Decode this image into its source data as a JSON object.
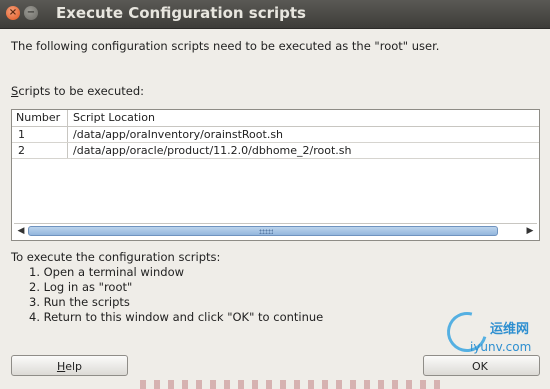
{
  "window": {
    "title": "Execute Configuration scripts"
  },
  "description": "The following configuration scripts need to be executed as the \"root\" user.",
  "scripts_label": {
    "first": "S",
    "rest": "cripts to be executed:"
  },
  "table": {
    "columns": [
      "Number",
      "Script Location"
    ],
    "rows": [
      {
        "number": "1",
        "location": "/data/app/oraInventory/orainstRoot.sh"
      },
      {
        "number": "2",
        "location": "/data/app/oracle/product/11.2.0/dbhome_2/root.sh"
      }
    ]
  },
  "instructions": {
    "heading": "To execute the configuration scripts:",
    "steps": [
      "1. Open a terminal window",
      "2. Log in as \"root\"",
      "3. Run the scripts",
      "4. Return to this window and click \"OK\" to continue"
    ]
  },
  "buttons": {
    "help_first": "H",
    "help_rest": "elp",
    "ok": "OK"
  },
  "watermark": {
    "line1": "运维网",
    "line2": "iyunv.com"
  },
  "colors": {
    "titlebar": "#3d3c39",
    "background": "#efede8",
    "scroll_thumb": "#94b6dd"
  }
}
